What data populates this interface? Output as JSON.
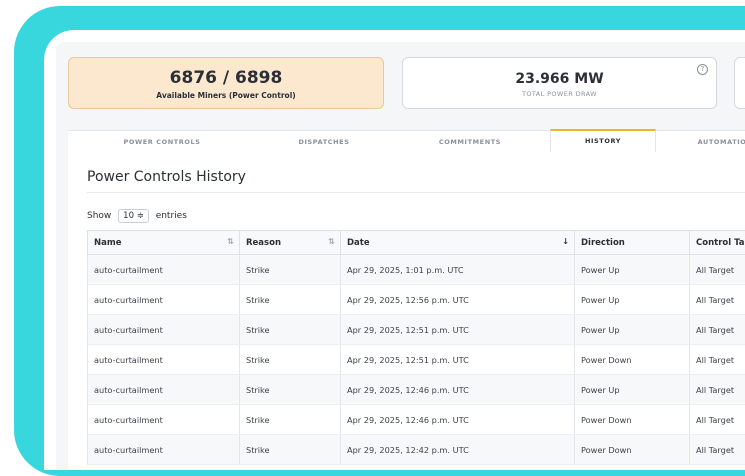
{
  "cards": {
    "miners": {
      "value": "6876 / 6898",
      "label": "Available Miners (Power Control)"
    },
    "power": {
      "value": "23.966 MW",
      "label": "TOTAL POWER DRAW",
      "help_icon": "?"
    }
  },
  "tabs": [
    {
      "label": "POWER CONTROLS",
      "active": false
    },
    {
      "label": "DISPATCHES",
      "active": false
    },
    {
      "label": "COMMITMENTS",
      "active": false
    },
    {
      "label": "HISTORY",
      "active": true
    },
    {
      "label": "AUTOMATIO",
      "active": false
    }
  ],
  "section_title": "Power Controls History",
  "show_entries": {
    "prefix": "Show",
    "value": "10 ≑",
    "suffix": "entries"
  },
  "table": {
    "columns": [
      {
        "label": "Name",
        "sort": "⇅"
      },
      {
        "label": "Reason",
        "sort": "⇅"
      },
      {
        "label": "Date",
        "sort": "↓"
      },
      {
        "label": "Direction",
        "sort": ""
      },
      {
        "label": "Control Tar",
        "sort": ""
      }
    ],
    "rows": [
      [
        "auto-curtailment",
        "Strike",
        "Apr 29, 2025, 1:01 p.m. UTC",
        "Power Up",
        "All Target"
      ],
      [
        "auto-curtailment",
        "Strike",
        "Apr 29, 2025, 12:56 p.m. UTC",
        "Power Up",
        "All Target"
      ],
      [
        "auto-curtailment",
        "Strike",
        "Apr 29, 2025, 12:51 p.m. UTC",
        "Power Up",
        "All Target"
      ],
      [
        "auto-curtailment",
        "Strike",
        "Apr 29, 2025, 12:51 p.m. UTC",
        "Power Down",
        "All Target"
      ],
      [
        "auto-curtailment",
        "Strike",
        "Apr 29, 2025, 12:46 p.m. UTC",
        "Power Up",
        "All Target"
      ],
      [
        "auto-curtailment",
        "Strike",
        "Apr 29, 2025, 12:46 p.m. UTC",
        "Power Down",
        "All Target"
      ],
      [
        "auto-curtailment",
        "Strike",
        "Apr 29, 2025, 12:42 p.m. UTC",
        "Power Down",
        "All Target"
      ]
    ]
  }
}
